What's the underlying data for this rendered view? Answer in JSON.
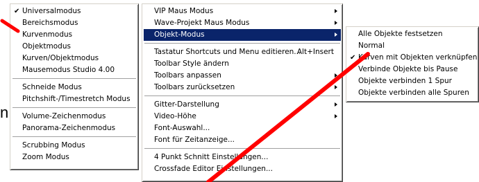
{
  "left_menu": {
    "groups": [
      [
        {
          "label": "Universalmodus",
          "checked": true
        },
        {
          "label": "Bereichsmodus"
        },
        {
          "label": "Kurvenmodus"
        },
        {
          "label": "Objektmodus"
        },
        {
          "label": "Kurven/Objektmodus"
        },
        {
          "label": "Mausemodus Studio 4.00"
        }
      ],
      [
        {
          "label": "Schneide Modus"
        },
        {
          "label": "Pitchshift-/Timestretch Modus"
        }
      ],
      [
        {
          "label": "Volume-Zeichenmodus"
        },
        {
          "label": "Panorama-Zeichenmodus"
        }
      ],
      [
        {
          "label": "Scrubbing Modus"
        },
        {
          "label": "Zoom Modus"
        }
      ]
    ]
  },
  "main_menu": {
    "groups": [
      [
        {
          "label": "VIP Maus Modus",
          "submenu": true
        },
        {
          "label": "Wave-Projekt Maus Modus",
          "submenu": true
        },
        {
          "label": "Objekt-Modus",
          "submenu": true,
          "selected": true
        }
      ],
      [
        {
          "label": "Tastatur Shortcuts und Menu editieren...",
          "shortcut": "Alt+Insert"
        },
        {
          "label": "Toolbar Style ändern"
        },
        {
          "label": "Toolbars anpassen",
          "submenu": true
        },
        {
          "label": "Toolbars zurücksetzen",
          "submenu": true
        }
      ],
      [
        {
          "label": "Gitter-Darstellung",
          "submenu": true
        },
        {
          "label": "Video-Höhe",
          "submenu": true
        },
        {
          "label": "Font-Auswahl..."
        },
        {
          "label": "Font für Zeitanzeige..."
        }
      ],
      [
        {
          "label": "4 Punkt Schnitt Einstellungen..."
        },
        {
          "label": "Crossfade Editor Einstellungen..."
        }
      ]
    ]
  },
  "sub_menu": {
    "groups": [
      [
        {
          "label": "Alle Objekte festsetzen"
        },
        {
          "label": "Normal"
        },
        {
          "label": "Kurven mit Objekten verknüpfen",
          "checked": true
        },
        {
          "label": "Verbinde Objekte bis Pause"
        },
        {
          "label": "Objekte verbinden 1 Spur"
        },
        {
          "label": "Objekte verbinden alle Spuren"
        }
      ]
    ]
  },
  "edge_fragment": "n",
  "colors": {
    "selection": "#0a246a",
    "annotation": "#ff0000",
    "menu_bg": "#ffffff"
  },
  "icons": {
    "check": "checkmark-icon",
    "submenu": "submenu-arrow-icon"
  }
}
